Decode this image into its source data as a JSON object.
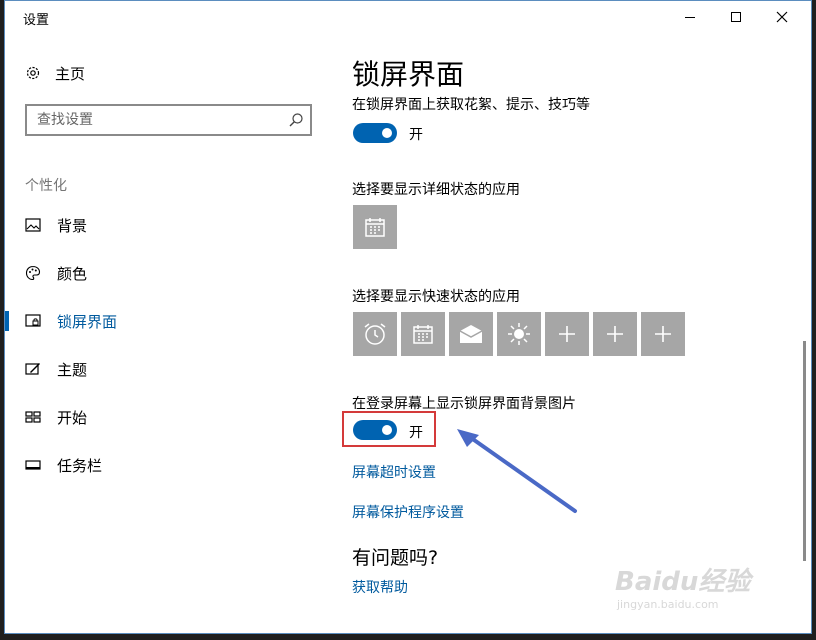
{
  "window": {
    "title": "设置"
  },
  "sidebar": {
    "home_label": "主页",
    "search_placeholder": "查找设置",
    "section_title": "个性化",
    "items": [
      {
        "label": "背景",
        "icon": "image-icon",
        "selected": false
      },
      {
        "label": "颜色",
        "icon": "palette-icon",
        "selected": false
      },
      {
        "label": "锁屏界面",
        "icon": "lock-screen-icon",
        "selected": true
      },
      {
        "label": "主题",
        "icon": "theme-icon",
        "selected": false
      },
      {
        "label": "开始",
        "icon": "start-icon",
        "selected": false
      },
      {
        "label": "任务栏",
        "icon": "taskbar-icon",
        "selected": false
      }
    ]
  },
  "main": {
    "title": "锁屏界面",
    "spotlight_label": "在锁屏界面上获取花絮、提示、技巧等",
    "spotlight_toggle": {
      "state": "开",
      "on": true
    },
    "detailed_status_label": "选择要显示详细状态的应用",
    "quick_status_label": "选择要显示快速状态的应用",
    "quick_status_icons": [
      "alarm-icon",
      "calendar-icon",
      "mail-icon",
      "weather-icon",
      "add-icon",
      "add-icon",
      "add-icon"
    ],
    "signin_bg_label": "在登录屏幕上显示锁屏界面背景图片",
    "signin_bg_toggle": {
      "state": "开",
      "on": true
    },
    "screen_timeout_link": "屏幕超时设置",
    "screensaver_link": "屏幕保护程序设置",
    "help_title": "有问题吗?",
    "help_link": "获取帮助"
  },
  "watermark": {
    "brand": "Baidu经验",
    "url": "jingyan.baidu.com"
  },
  "colors": {
    "accent": "#0063b1",
    "link": "#005a9e",
    "tile": "#a6a6a6",
    "highlight": "#d43a3a",
    "arrow": "#4a69c6"
  }
}
